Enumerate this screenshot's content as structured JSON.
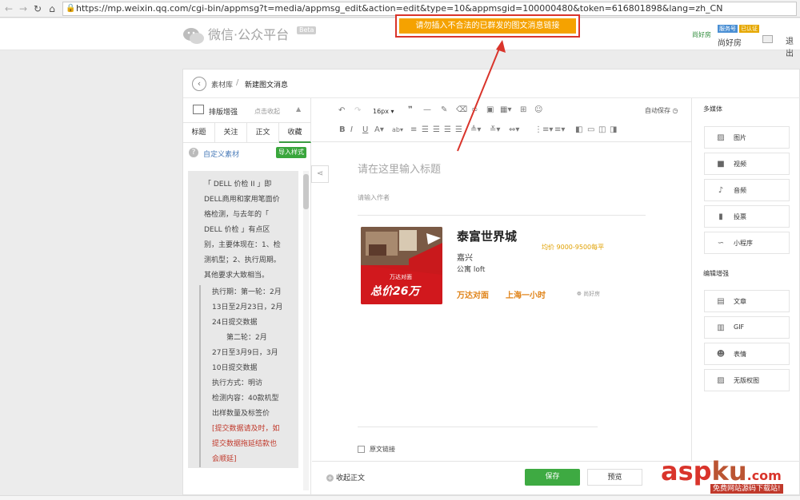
{
  "browser": {
    "url": "https://mp.weixin.qq.com/cgi-bin/appmsg?t=media/appmsg_edit&action=edit&type=10&appmsgid=100000480&token=616801898&lang=zh_CN"
  },
  "header": {
    "logo_text": "微信·公众平台",
    "beta": "Beta",
    "warning": "请勿插入不合法的已群发的图文消息链接",
    "account_avatar_text": "尚好房",
    "badge_service": "服务号",
    "badge_verified": "已认证",
    "account_name": "尚好房",
    "logout": "退出"
  },
  "breadcrumb": {
    "parent": "素材库",
    "separator": "/",
    "current": "新建图文消息"
  },
  "left": {
    "header_title": "排版增强",
    "collapse": "点击收起",
    "tabs": [
      "标题",
      "关注",
      "正文",
      "收藏"
    ],
    "active_tab": 3,
    "custom_link": "自定义素材",
    "import_button": "导入样式",
    "content_lines": [
      "「 DELL 价检 II 」即",
      "DELL商用和家用笔面价",
      "格检测，与去年的「",
      "DELL 价检 」有点区",
      "别，主要体现在：1、检",
      "测机型；2、执行周期。",
      "其他要求大致相当。"
    ],
    "content_lines2": [
      "执行期：第一轮：2月",
      "13日至2月23日，2月",
      "24日提交数据",
      "　　第二轮：2月",
      "27日至3月9日，3月",
      "10日提交数据",
      "执行方式：明访",
      "检测内容：40款机型",
      "出样数量及标签价"
    ],
    "content_red": [
      "[提交数据请及时，如",
      "提交数据拖延结款也",
      "会顺延]"
    ]
  },
  "toolbar": {
    "font_size": "16px",
    "autosave": "自动保存"
  },
  "editor": {
    "title_placeholder": "请在这里输入标题",
    "author_placeholder": "请输入作者",
    "original_link": "原文链接"
  },
  "card": {
    "image_caption": "万达对面",
    "image_price": "总价26万",
    "title": "泰富世界城",
    "price": "均价 9000-9500每平",
    "city": "嘉兴",
    "type": "公寓 loft",
    "tag1": "万达对面",
    "tag2": "上海一小时",
    "brand": "尚好房"
  },
  "right": {
    "multimedia_title": "多媒体",
    "media_items": [
      {
        "label": "图片",
        "icon": "image-icon"
      },
      {
        "label": "视频",
        "icon": "video-icon"
      },
      {
        "label": "音频",
        "icon": "audio-icon"
      },
      {
        "label": "投票",
        "icon": "vote-icon"
      },
      {
        "label": "小程序",
        "icon": "miniprogram-icon"
      }
    ],
    "enhance_title": "编辑增强",
    "enhance_items": [
      {
        "label": "文章",
        "icon": "article-icon"
      },
      {
        "label": "GIF",
        "icon": "gif-icon"
      },
      {
        "label": "表情",
        "icon": "emoji-icon"
      },
      {
        "label": "无版权图",
        "icon": "copyright-free-image-icon"
      }
    ]
  },
  "footer": {
    "collapse": "收起正文",
    "save": "保存",
    "preview": "预览"
  },
  "watermark": {
    "text_asp": "asp",
    "text_ku": "ku",
    "text_dotcom": ".com",
    "subtitle": "免费网站源码下载站!"
  },
  "colors": {
    "accent_green": "#3eaa42",
    "warning_orange": "#f5a200",
    "annotation_red": "#d9342b"
  }
}
